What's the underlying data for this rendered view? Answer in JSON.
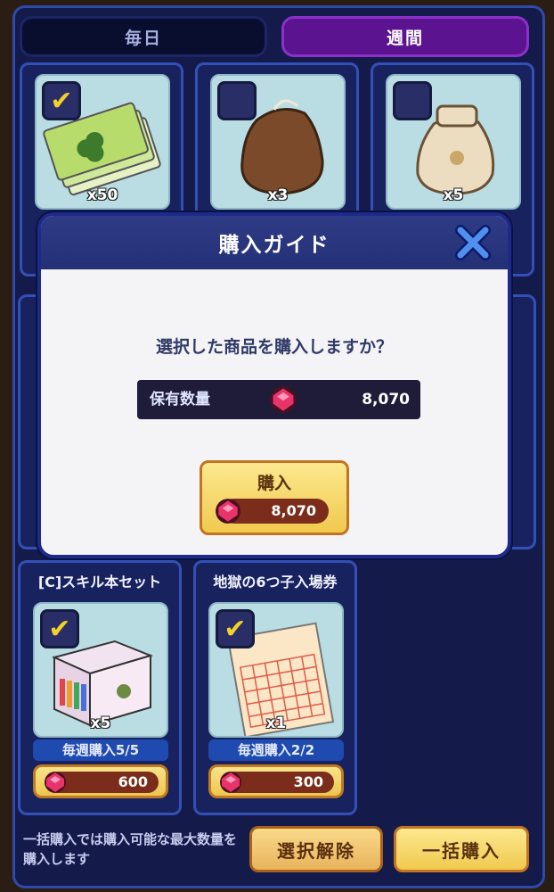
{
  "tabs": {
    "daily": "毎日",
    "weekly": "週間"
  },
  "top_items": [
    {
      "qty": "x50",
      "checked": true
    },
    {
      "qty": "x3",
      "checked": false
    },
    {
      "qty": "x5",
      "checked": false
    }
  ],
  "bottom_items": [
    {
      "title": "[C]スキル本セット",
      "qty": "x5",
      "limit": "毎週購入5/5",
      "price": "600",
      "checked": true
    },
    {
      "title": "地獄の6つ子入場券",
      "qty": "x1",
      "limit": "毎週購入2/2",
      "price": "300",
      "checked": true
    }
  ],
  "modal": {
    "title": "購入ガイド",
    "question": "選択した商品を購入しますか？",
    "holding_label": "保有数量",
    "holding_value": "8,070",
    "buy_label": "購入",
    "buy_price": "8,070"
  },
  "footer": {
    "note": "一括購入では購入可能な最大数量を購入します",
    "deselect_label": "選択解除",
    "bulk_label": "一括購入"
  },
  "colors": {
    "gem": "#e8336b",
    "accent": "#5b138f"
  }
}
